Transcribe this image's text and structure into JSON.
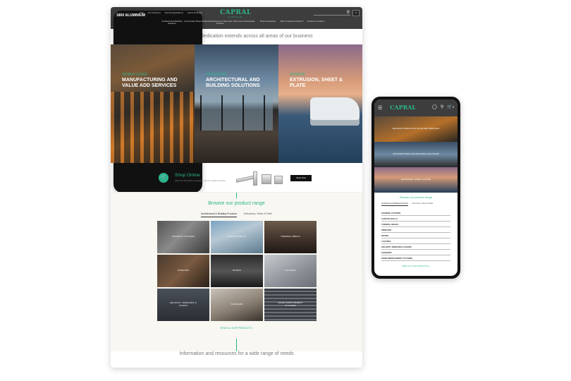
{
  "desktop": {
    "header": {
      "phone": "1800 ALUMINIUM",
      "top_links": [
        "Why",
        "Pro Solutions",
        "Events Applications",
        "Latest Products",
        ""
      ],
      "logo": "CAPRAL",
      "logo_sub": "ALUMINIUM",
      "search_icon": "search-icon",
      "account_label": "",
      "nav": [
        "Architectural & Building Solutions",
        "Commercial, Sheet & Plate",
        "Manufacturing & Value Add Services",
        "Resources & Downloads",
        "Project Showcase",
        "Who is Capral Aluminium?",
        "Contact & Locations"
      ]
    },
    "tagline": "Our expertise and dedication extends across all areas of our business",
    "hero": [
      {
        "tag": "WORLD CLASS",
        "title": "MANUFACTURING AND VALUE ADD SERVICES"
      },
      {
        "tag": "INNOVATIVE",
        "title": "ARCHITECTURAL AND BUILDING SOLUTIONS"
      },
      {
        "tag": "DIVERSE",
        "title": "EXTRUSION, SHEET & PLATE"
      }
    ],
    "shop": {
      "title": "Shop Online",
      "subtitle": "Shop for aluminium extrusions, sheet & plate products",
      "button": "Shop Now"
    },
    "browse": {
      "title": "Browse our product range",
      "tabs": [
        "Architectural & Building Products",
        "Extrusions, Sheet & Plate"
      ],
      "active_tab": 0,
      "tiles": [
        "FRAMING SYSTEMS",
        "CURTAIN WALLS",
        "THERMAL BREAK",
        "WINDOWS",
        "DOORS",
        "LOUVRES",
        "SECURITY WINDOWS & DOORS",
        "SHOWERS",
        "HOME IMPROVEMENT SYSTEMS"
      ],
      "view_all": "VIEW ALL OUR PRODUCTS"
    },
    "bottom_heading": "Information and resources for a wide range of needs"
  },
  "mobile": {
    "logo": "CAPRAL",
    "icons": [
      "menu-icon",
      "user-icon",
      "search-icon",
      "cart-icon"
    ],
    "cart_count": "0",
    "hero": [
      "MANUFACTURING AND VALUE ADD SERVICES",
      "ARCHITECTURAL AND BUILDING SOLUTIONS",
      "EXTRUSION, SHEET & PLATE"
    ],
    "browse_title": "Browse our product range",
    "tabs": [
      "Architectural & Building Products",
      "Extrusions, Sheet & Plate"
    ],
    "list": [
      "FRAMING SYSTEMS",
      "CURTAIN WALLS",
      "THERMAL BREAK",
      "WINDOWS",
      "DOORS",
      "LOUVRES",
      "SECURITY WINDOWS & DOORS",
      "SHOWERS",
      "HOME IMPROVEMENT SYSTEMS"
    ],
    "view_all": "VIEW ALL OUR PRODUCTS"
  },
  "colors": {
    "brand_green": "#2bb58a",
    "header_dark": "#3d3d3d"
  }
}
